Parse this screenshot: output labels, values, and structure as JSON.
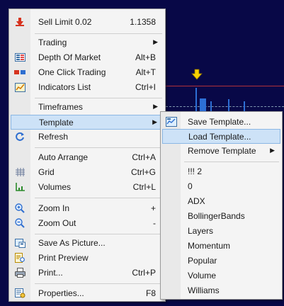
{
  "chart": {
    "background": "#080847",
    "price_line_color": "#b0303a",
    "marker_icon": "down-arrow-yellow-icon"
  },
  "main_menu": {
    "items": [
      {
        "label": "Sell Limit 0.02",
        "shortcut": "1.1358",
        "icon": "sell-arrow-icon"
      },
      {
        "label": "Trading",
        "shortcut": "",
        "icon": "",
        "submenu": true
      },
      {
        "label": "Depth Of Market",
        "shortcut": "Alt+B",
        "icon": "depth-of-market-icon"
      },
      {
        "label": "One Click Trading",
        "shortcut": "Alt+T",
        "icon": "one-click-trading-icon"
      },
      {
        "label": "Indicators List",
        "shortcut": "Ctrl+I",
        "icon": "indicators-list-icon"
      },
      {
        "label": "Timeframes",
        "shortcut": "",
        "icon": "",
        "submenu": true
      },
      {
        "label": "Template",
        "shortcut": "",
        "icon": "",
        "submenu": true,
        "highlighted": true
      },
      {
        "label": "Refresh",
        "shortcut": "",
        "icon": "refresh-icon"
      },
      {
        "label": "Auto Arrange",
        "shortcut": "Ctrl+A",
        "icon": ""
      },
      {
        "label": "Grid",
        "shortcut": "Ctrl+G",
        "icon": "grid-icon"
      },
      {
        "label": "Volumes",
        "shortcut": "Ctrl+L",
        "icon": "volumes-icon"
      },
      {
        "label": "Zoom In",
        "shortcut": "+",
        "icon": "zoom-in-icon"
      },
      {
        "label": "Zoom Out",
        "shortcut": "-",
        "icon": "zoom-out-icon"
      },
      {
        "label": "Save As Picture...",
        "shortcut": "",
        "icon": "save-picture-icon"
      },
      {
        "label": "Print Preview",
        "shortcut": "",
        "icon": "print-preview-icon"
      },
      {
        "label": "Print...",
        "shortcut": "Ctrl+P",
        "icon": "printer-icon"
      },
      {
        "label": "Properties...",
        "shortcut": "F8",
        "icon": "properties-icon"
      }
    ]
  },
  "template_menu": {
    "items": [
      {
        "label": "Save Template...",
        "icon": "save-template-icon"
      },
      {
        "label": "Load Template...",
        "highlighted": true
      },
      {
        "label": "Remove Template",
        "submenu": true
      },
      {
        "label": "!!! 2"
      },
      {
        "label": "0"
      },
      {
        "label": "ADX"
      },
      {
        "label": "BollingerBands"
      },
      {
        "label": "Layers"
      },
      {
        "label": "Momentum"
      },
      {
        "label": "Popular"
      },
      {
        "label": "Volume"
      },
      {
        "label": "Williams"
      }
    ]
  },
  "colors": {
    "highlight": "#cde2f7",
    "highlight_border": "#8bb7e4",
    "menu_bg": "#f4f4f4"
  }
}
